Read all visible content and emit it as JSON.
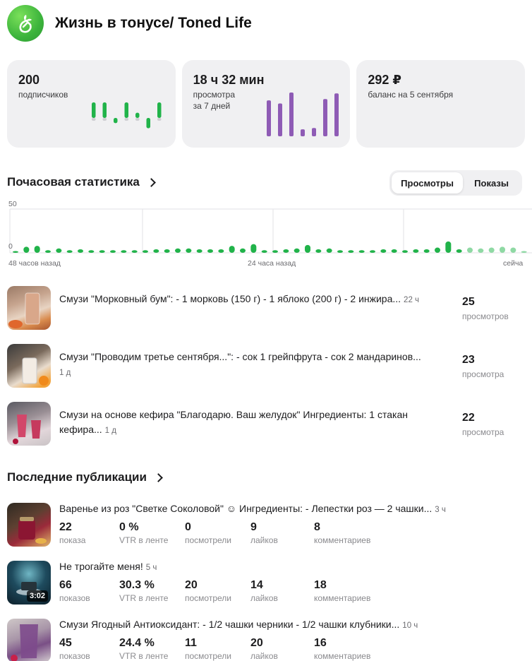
{
  "channel": {
    "title": "Жизнь в тонусе/ Toned Life"
  },
  "cards": {
    "subscribers": {
      "value": "200",
      "label": "подписчиков",
      "changes": [
        3,
        3,
        -1,
        3,
        1,
        -2,
        3
      ]
    },
    "views": {
      "value_h": "18",
      "unit_h": "ч",
      "value_m": "32",
      "unit_m": "мин",
      "label_line1": "просмотра",
      "label_line2": "за 7 дней",
      "values": [
        82,
        75,
        100,
        16,
        19,
        85,
        98
      ]
    },
    "balance": {
      "value": "292 ₽",
      "label": "баланс на 5 сентября"
    }
  },
  "hourly": {
    "title": "Почасовая статистика",
    "tabs": {
      "views": "Просмотры",
      "impressions": "Показы"
    },
    "active_tab": "views",
    "y_ticks": [
      "50",
      "0"
    ],
    "x_labels": {
      "start": "48 часов назад",
      "middle": "24 часа назад",
      "end": "сейча"
    },
    "chart_data": {
      "type": "bar",
      "ylim": [
        0,
        50
      ],
      "values": [
        2,
        7,
        8,
        3,
        5,
        3,
        4,
        3,
        3,
        3,
        3,
        3,
        3,
        4,
        4,
        5,
        5,
        4,
        4,
        4,
        8,
        5,
        10,
        3,
        3,
        4,
        5,
        9,
        4,
        5,
        3,
        3,
        3,
        3,
        4,
        4,
        3,
        4,
        4,
        6,
        13,
        4,
        6,
        5,
        6,
        7,
        6,
        2
      ],
      "highlight_from": 42,
      "colors": {
        "bar": "#21b34a",
        "bar_light": "#8fd9a4",
        "grid": "#e2e2e6"
      }
    }
  },
  "top_posts": [
    {
      "title": "Смузи \"Морковный бум\": - 1 морковь (150 г) - 1 яблоко (200 г) - 2 инжира...",
      "age": "22 ч",
      "value": "25",
      "label": "просмотров"
    },
    {
      "title": "Смузи \"Проводим третье сентября...\": - сок 1 грейпфрута - сок 2 мандаринов...",
      "age": "1 д",
      "value": "23",
      "label": "просмотра"
    },
    {
      "title": "Смузи на основе кефира \"Благодарю. Ваш желудок\" Ингредиенты: 1 стакан кефира...",
      "age": "1 д",
      "value": "22",
      "label": "просмотра"
    }
  ],
  "publications": {
    "title": "Последние публикации",
    "stat_labels": [
      "показа",
      "VTR в ленте",
      "посмотрели",
      "лайков",
      "комментариев"
    ],
    "items": [
      {
        "title": "Варенье из роз \"Светке Соколовой\" ☺ Ингредиенты: - Лепестки роз — 2 чашки...",
        "age": "3 ч",
        "stats": [
          "22",
          "0 %",
          "0",
          "9",
          "8"
        ],
        "labels": [
          "показа",
          "VTR в ленте",
          "посмотрели",
          "лайков",
          "комментариев"
        ]
      },
      {
        "title": "Не трогайте меня!",
        "age": "5 ч",
        "duration": "3:02",
        "stats": [
          "66",
          "30.3 %",
          "20",
          "14",
          "18"
        ],
        "labels": [
          "показов",
          "VTR в ленте",
          "посмотрели",
          "лайков",
          "комментариев"
        ]
      },
      {
        "title": "Смузи Ягодный Антиоксидант: - 1/2 чашки черники - 1/2 чашки клубники...",
        "age": "10 ч",
        "stats": [
          "45",
          "24.4 %",
          "11",
          "20",
          "16"
        ],
        "labels": [
          "показов",
          "VTR в ленте",
          "посмотрели",
          "лайков",
          "комментариев"
        ]
      }
    ]
  },
  "colors": {
    "green": "#21b34a",
    "purple": "#8e5bb5",
    "card_bg": "#f0f0f2"
  }
}
